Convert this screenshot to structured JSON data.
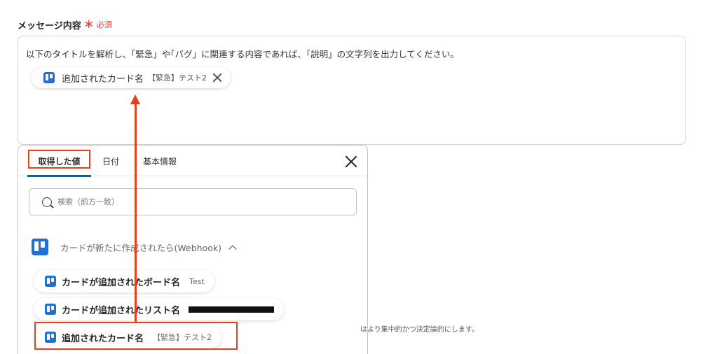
{
  "field": {
    "label": "メッセージ内容",
    "required_mark": "＊",
    "required_text": "必須"
  },
  "textarea": {
    "prompt": "以下のタイトルを解析し、｢緊急」や｢バグ」に関連する内容であれば、｢説明」の文字列を出力してください。",
    "chip": {
      "label": "追加されたカード名",
      "value": "【緊急】テスト2",
      "icon": "trello-icon"
    }
  },
  "popup": {
    "tabs": [
      {
        "label": "取得した値",
        "active": true
      },
      {
        "label": "日付",
        "active": false
      },
      {
        "label": "基本情報",
        "active": false
      }
    ],
    "search_placeholder": "検索（前方一致）",
    "group": {
      "title": "カードが新たに作成されたら(Webhook)",
      "icon": "trello-icon",
      "expanded": true
    },
    "items": [
      {
        "label": "カードが追加されたボード名",
        "value": "Test"
      },
      {
        "label": "カードが追加されたリスト名",
        "value": ""
      },
      {
        "label": "追加されたカード名",
        "value": "【緊急】テスト2"
      }
    ]
  },
  "helper_text": "はより集中的かつ決定論的にします。",
  "colors": {
    "highlight": "#e8401c",
    "accent": "#1b5f8a",
    "trello": "#1f6fd6",
    "required": "#e53935"
  }
}
